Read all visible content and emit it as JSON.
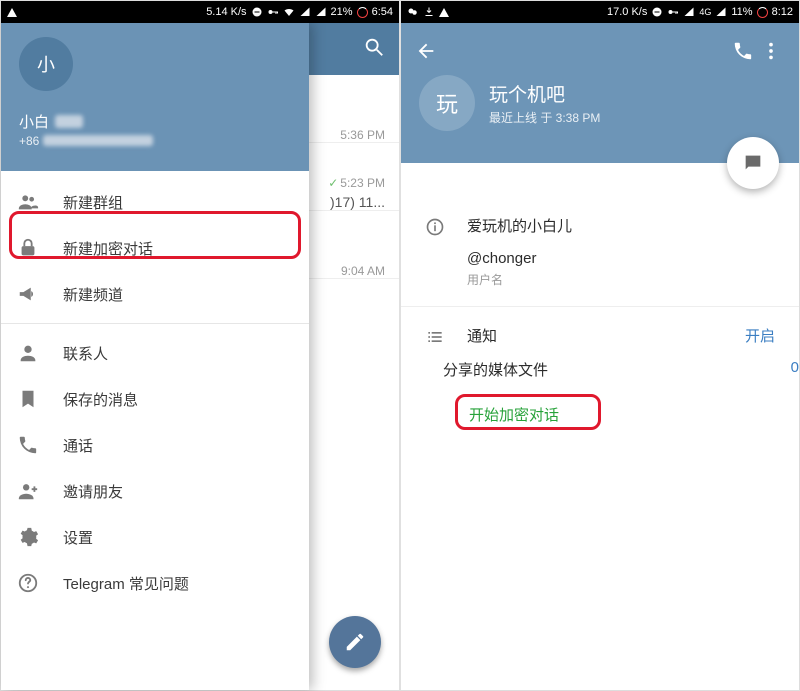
{
  "left": {
    "status": {
      "speed": "5.14 K/s",
      "battery": "21%",
      "time": "6:54"
    },
    "user": {
      "avatar_initial": "小",
      "name": "小白",
      "phone": "+86"
    },
    "drawer": {
      "new_group": "新建群组",
      "new_secret": "新建加密对话",
      "new_channel": "新建频道",
      "contacts": "联系人",
      "saved": "保存的消息",
      "calls": "通话",
      "invite": "邀请朋友",
      "settings": "设置",
      "faq": "Telegram 常见问题"
    },
    "chat_peek": {
      "row1_time": "5:36 PM",
      "row2_time": "5:23 PM",
      "row2_sub": ")17) 11...",
      "row3_time": "9:04 AM"
    }
  },
  "right": {
    "status": {
      "speed": "17.0 K/s",
      "net": "4G",
      "battery": "11%",
      "time": "8:12"
    },
    "profile": {
      "avatar_initial": "玩",
      "title": "玩个机吧",
      "last_seen_prefix": "最近上线 于 ",
      "last_seen_time": "3:38 PM",
      "display_name": "爱玩机的小白儿",
      "username": "@chonger",
      "username_label": "用户名"
    },
    "rows": {
      "notifications_label": "通知",
      "notifications_value": "开启",
      "shared_media_label": "分享的媒体文件",
      "shared_media_value": "0",
      "start_secret_chat": "开始加密对话"
    }
  }
}
